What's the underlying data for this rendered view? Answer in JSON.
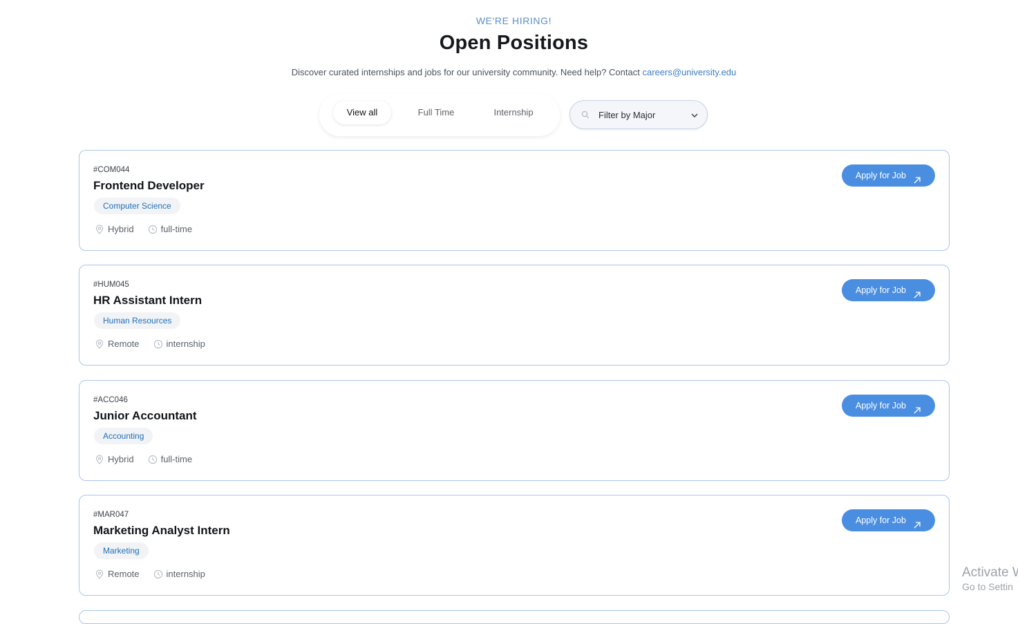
{
  "header": {
    "eyebrow": "WE'RE HIRING!",
    "title": "Open Positions",
    "subtitle_text": "Discover curated internships and jobs for our university community. Need help? Contact ",
    "contact_email": "careers@university.edu"
  },
  "tabs": [
    {
      "label": "View all",
      "active": true
    },
    {
      "label": "Full Time",
      "active": false
    },
    {
      "label": "Internship",
      "active": false
    }
  ],
  "filter": {
    "label": "Filter by Major",
    "icon": "search-icon",
    "dropdown_icon": "chevron-down-icon"
  },
  "jobs": [
    {
      "code": "#COM044",
      "title": "Frontend Developer",
      "major": "Computer Science",
      "location": "Hybrid",
      "type": "full-time",
      "apply_label": "Apply for Job"
    },
    {
      "code": "#HUM045",
      "title": "HR Assistant Intern",
      "major": "Human Resources",
      "location": "Remote",
      "type": "internship",
      "apply_label": "Apply for Job"
    },
    {
      "code": "#ACC046",
      "title": "Junior Accountant",
      "major": "Accounting",
      "location": "Hybrid",
      "type": "full-time",
      "apply_label": "Apply for Job"
    },
    {
      "code": "#MAR047",
      "title": "Marketing Analyst Intern",
      "major": "Marketing",
      "location": "Remote",
      "type": "internship",
      "apply_label": "Apply for Job"
    }
  ],
  "watermark": {
    "line1": "Activate W",
    "line2": "Go to Settin"
  },
  "colors": {
    "accent": "#4a8ee2",
    "card_border": "#a9c6ea",
    "tag_text": "#1f6fb8"
  }
}
